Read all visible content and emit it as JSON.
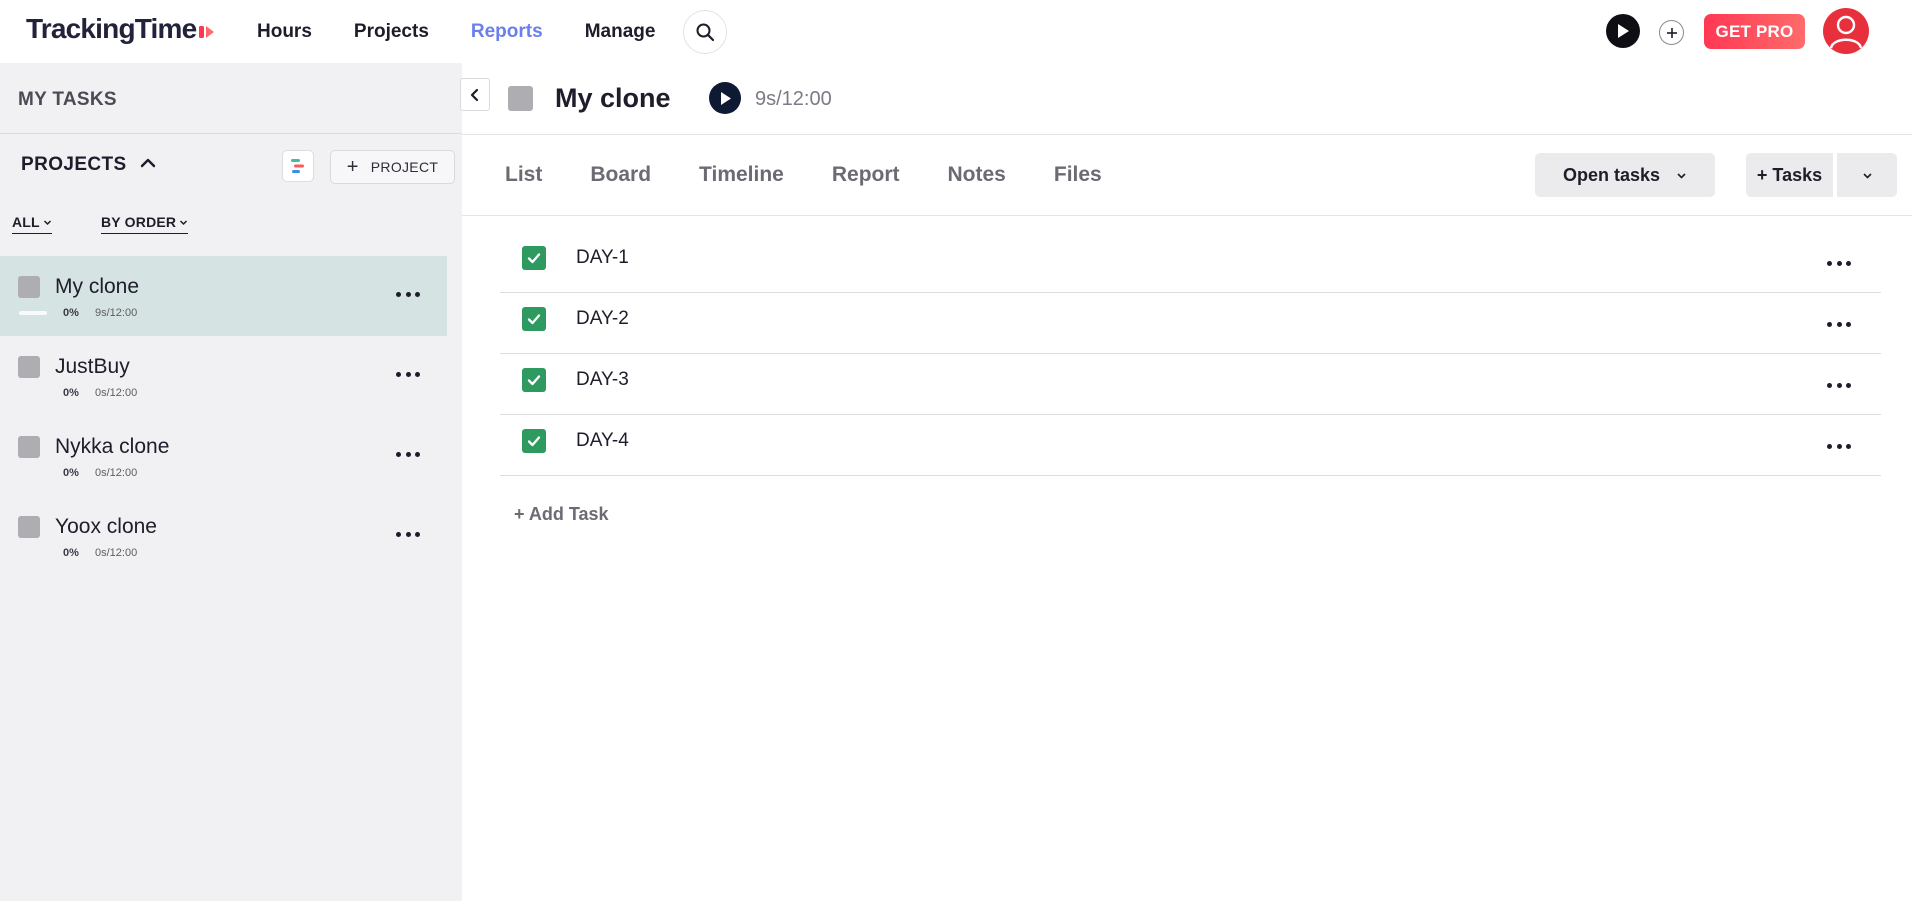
{
  "brand": {
    "name": "TrackingTime"
  },
  "nav": {
    "items": [
      "Hours",
      "Projects",
      "Reports",
      "Manage"
    ],
    "active": "Reports"
  },
  "topbar": {
    "get_pro_label": "GET PRO"
  },
  "sidebar": {
    "my_tasks_label": "MY TASKS",
    "projects_label": "PROJECTS",
    "add_project_label": "PROJECT",
    "filter_all_label": "ALL",
    "filter_order_label": "BY ORDER",
    "projects": [
      {
        "name": "My clone",
        "progress": "0%",
        "time": "9s/12:00",
        "selected": true
      },
      {
        "name": "JustBuy",
        "progress": "0%",
        "time": "0s/12:00",
        "selected": false
      },
      {
        "name": "Nykka clone",
        "progress": "0%",
        "time": "0s/12:00",
        "selected": false
      },
      {
        "name": "Yoox clone",
        "progress": "0%",
        "time": "0s/12:00",
        "selected": false
      }
    ]
  },
  "main": {
    "title": "My clone",
    "time": "9s/12:00",
    "tabs": [
      "List",
      "Board",
      "Timeline",
      "Report",
      "Notes",
      "Files"
    ],
    "open_tasks_label": "Open tasks",
    "add_tasks_label": "+ Tasks",
    "tasks": [
      {
        "name": "DAY-1",
        "done": true
      },
      {
        "name": "DAY-2",
        "done": true
      },
      {
        "name": "DAY-3",
        "done": true
      },
      {
        "name": "DAY-4",
        "done": true
      }
    ],
    "add_task_label": "+ Add Task"
  },
  "colors": {
    "accent_nav": "#6a7fe8",
    "get_pro": "#ff3853",
    "check_green": "#2f9a5f",
    "selected_project_bg": "#d6e3e3"
  },
  "icons": {
    "search": "search-icon",
    "play": "play-icon",
    "plus": "plus-icon",
    "avatar": "user-avatar-icon",
    "chevron_up": "chevron-up-icon",
    "chevron_left": "chevron-left-icon",
    "chevron_down": "chevron-down-icon",
    "gantt": "gantt-icon",
    "check": "check-icon",
    "more": "more-horizontal-icon"
  }
}
